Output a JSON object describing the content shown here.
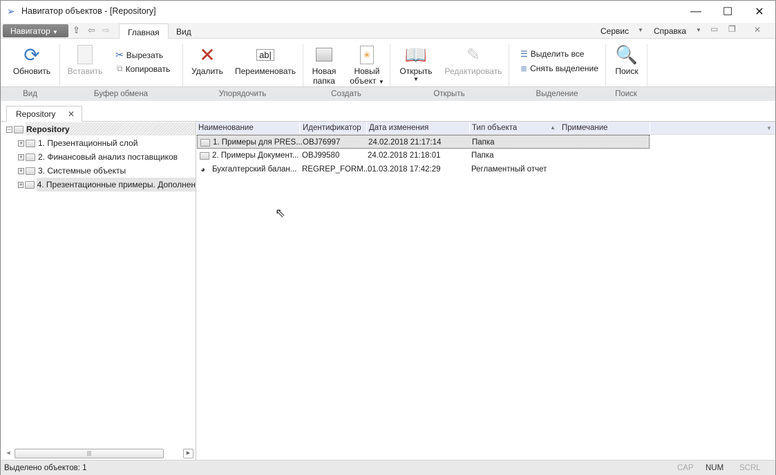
{
  "window": {
    "title": "Навигатор объектов - [Repository]",
    "minimize": "—",
    "maximize": "☐",
    "close": "✕"
  },
  "menu": {
    "navigator": "Навигатор",
    "tabs": [
      "Главная",
      "Вид"
    ],
    "service": "Сервис",
    "help": "Справка"
  },
  "ribbon": {
    "refresh": "Обновить",
    "paste": "Вставить",
    "cut": "Вырезать",
    "copy": "Копировать",
    "delete": "Удалить",
    "rename": "Переименовать",
    "new_folder": [
      "Новая",
      "папка"
    ],
    "new_object": [
      "Новый",
      "объект"
    ],
    "open": "Открыть",
    "edit": "Редактировать",
    "select_all": "Выделить все",
    "deselect": "Снять выделение",
    "search": "Поиск",
    "rename_icon_text": "ab|",
    "groups": [
      "Вид",
      "Буфер обмена",
      "Упорядочить",
      "Создать",
      "Открыть",
      "Выделение",
      "Поиск"
    ]
  },
  "doc_tab": {
    "label": "Repository",
    "close": "✕"
  },
  "tree": {
    "root": "Repository",
    "items": [
      "1. Презентационный слой",
      "2. Финансовый анализ поставщиков",
      "3. Системные объекты",
      "4. Презентационные примеры. Дополнен"
    ]
  },
  "grid": {
    "columns": [
      "Наименование",
      "Идентификатор",
      "Дата изменения",
      "Тип объекта",
      "Примечание"
    ],
    "rows": [
      {
        "name": "1. Примеры для PRES...",
        "id": "OBJ76997",
        "date": "24.02.2018 21:17:14",
        "type": "Папка",
        "icon": "folder"
      },
      {
        "name": "2. Примеры Документ...",
        "id": "OBJ99580",
        "date": "24.02.2018 21:18:01",
        "type": "Папка",
        "icon": "folder"
      },
      {
        "name": "Бухгалтерский балан...",
        "id": "REGREP_FORM...",
        "date": "01.03.2018 17:42:29",
        "type": "Регламентный отчет",
        "icon": "report"
      }
    ]
  },
  "status": {
    "text": "Выделено объектов: 1",
    "cap": "CAP",
    "num": "NUM",
    "scrl": "SCRL"
  },
  "colors": {
    "accent": "#3c6eb4",
    "delete": "#c0392b",
    "header": "#e8eaf6"
  }
}
